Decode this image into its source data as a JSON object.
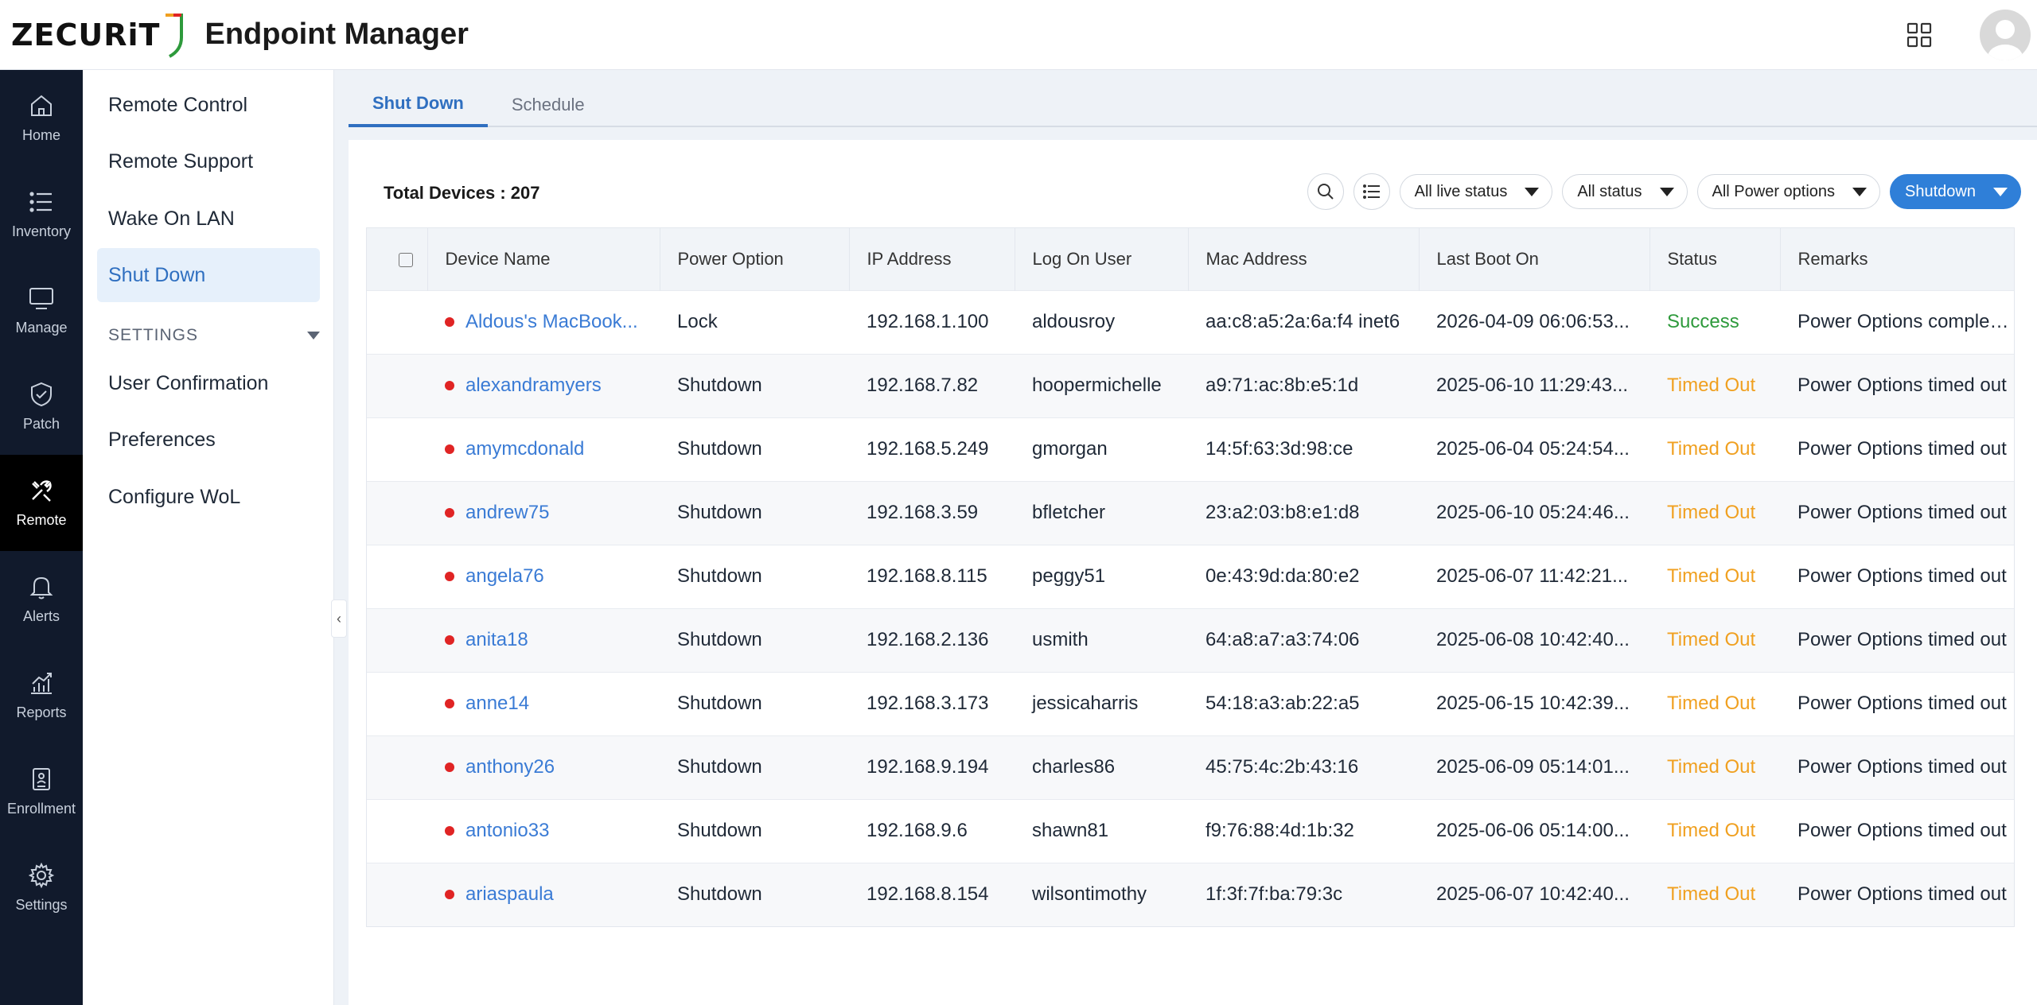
{
  "header": {
    "logo_text": "ZECURiT",
    "app_title": "Endpoint Manager"
  },
  "leftnav": [
    {
      "label": "Home",
      "icon": "home-icon"
    },
    {
      "label": "Inventory",
      "icon": "list-icon"
    },
    {
      "label": "Manage",
      "icon": "monitor-icon"
    },
    {
      "label": "Patch",
      "icon": "shield-check-icon"
    },
    {
      "label": "Remote",
      "icon": "tools-icon",
      "active": true
    },
    {
      "label": "Alerts",
      "icon": "bell-icon"
    },
    {
      "label": "Reports",
      "icon": "chart-icon"
    },
    {
      "label": "Enrollment",
      "icon": "document-icon"
    },
    {
      "label": "Settings",
      "icon": "gear-icon"
    }
  ],
  "subnav": {
    "items": [
      "Remote Control",
      "Remote Support",
      "Wake On LAN",
      "Shut Down"
    ],
    "settings_heading": "SETTINGS",
    "settings_items": [
      "User Confirmation",
      "Preferences",
      "Configure WoL"
    ]
  },
  "tabs": [
    "Shut Down",
    "Schedule"
  ],
  "total_devices": "Total Devices : 207",
  "filters": {
    "live_status": "All live status",
    "status": "All status",
    "power_options": "All Power options",
    "action": "Shutdown"
  },
  "table": {
    "columns": [
      "Device Name",
      "Power Option",
      "IP Address",
      "Log On User",
      "Mac Address",
      "Last Boot On",
      "Status",
      "Remarks"
    ],
    "rows": [
      {
        "device": "Aldous's MacBook...",
        "power": "Lock",
        "ip": "192.168.1.100",
        "user": "aldousroy",
        "mac": "aa:c8:a5:2a:6a:f4 inet6",
        "boot": "2026-04-09 06:06:53...",
        "status": "Success",
        "remarks": "Power Options completed"
      },
      {
        "device": "alexandramyers",
        "power": "Shutdown",
        "ip": "192.168.7.82",
        "user": "hoopermichelle",
        "mac": "a9:71:ac:8b:e5:1d",
        "boot": "2025-06-10 11:29:43...",
        "status": "Timed Out",
        "remarks": "Power Options timed out"
      },
      {
        "device": "amymcdonald",
        "power": "Shutdown",
        "ip": "192.168.5.249",
        "user": "gmorgan",
        "mac": "14:5f:63:3d:98:ce",
        "boot": "2025-06-04 05:24:54...",
        "status": "Timed Out",
        "remarks": "Power Options timed out"
      },
      {
        "device": "andrew75",
        "power": "Shutdown",
        "ip": "192.168.3.59",
        "user": "bfletcher",
        "mac": "23:a2:03:b8:e1:d8",
        "boot": "2025-06-10 05:24:46...",
        "status": "Timed Out",
        "remarks": "Power Options timed out"
      },
      {
        "device": "angela76",
        "power": "Shutdown",
        "ip": "192.168.8.115",
        "user": "peggy51",
        "mac": "0e:43:9d:da:80:e2",
        "boot": "2025-06-07 11:42:21...",
        "status": "Timed Out",
        "remarks": "Power Options timed out"
      },
      {
        "device": "anita18",
        "power": "Shutdown",
        "ip": "192.168.2.136",
        "user": "usmith",
        "mac": "64:a8:a7:a3:74:06",
        "boot": "2025-06-08 10:42:40...",
        "status": "Timed Out",
        "remarks": "Power Options timed out"
      },
      {
        "device": "anne14",
        "power": "Shutdown",
        "ip": "192.168.3.173",
        "user": "jessicaharris",
        "mac": "54:18:a3:ab:22:a5",
        "boot": "2025-06-15 10:42:39...",
        "status": "Timed Out",
        "remarks": "Power Options timed out"
      },
      {
        "device": "anthony26",
        "power": "Shutdown",
        "ip": "192.168.9.194",
        "user": "charles86",
        "mac": "45:75:4c:2b:43:16",
        "boot": "2025-06-09 05:14:01...",
        "status": "Timed Out",
        "remarks": "Power Options timed out"
      },
      {
        "device": "antonio33",
        "power": "Shutdown",
        "ip": "192.168.9.6",
        "user": "shawn81",
        "mac": "f9:76:88:4d:1b:32",
        "boot": "2025-06-06 05:14:00...",
        "status": "Timed Out",
        "remarks": "Power Options timed out"
      },
      {
        "device": "ariaspaula",
        "power": "Shutdown",
        "ip": "192.168.8.154",
        "user": "wilsontimothy",
        "mac": "1f:3f:7f:ba:79:3c",
        "boot": "2025-06-07 10:42:40...",
        "status": "Timed Out",
        "remarks": "Power Options timed out"
      }
    ]
  },
  "colors": {
    "accent": "#2f7fd8",
    "nav_bg": "#111a2c",
    "success": "#2e9a3c",
    "timed_out": "#f0a020",
    "offline_dot": "#e02424"
  }
}
